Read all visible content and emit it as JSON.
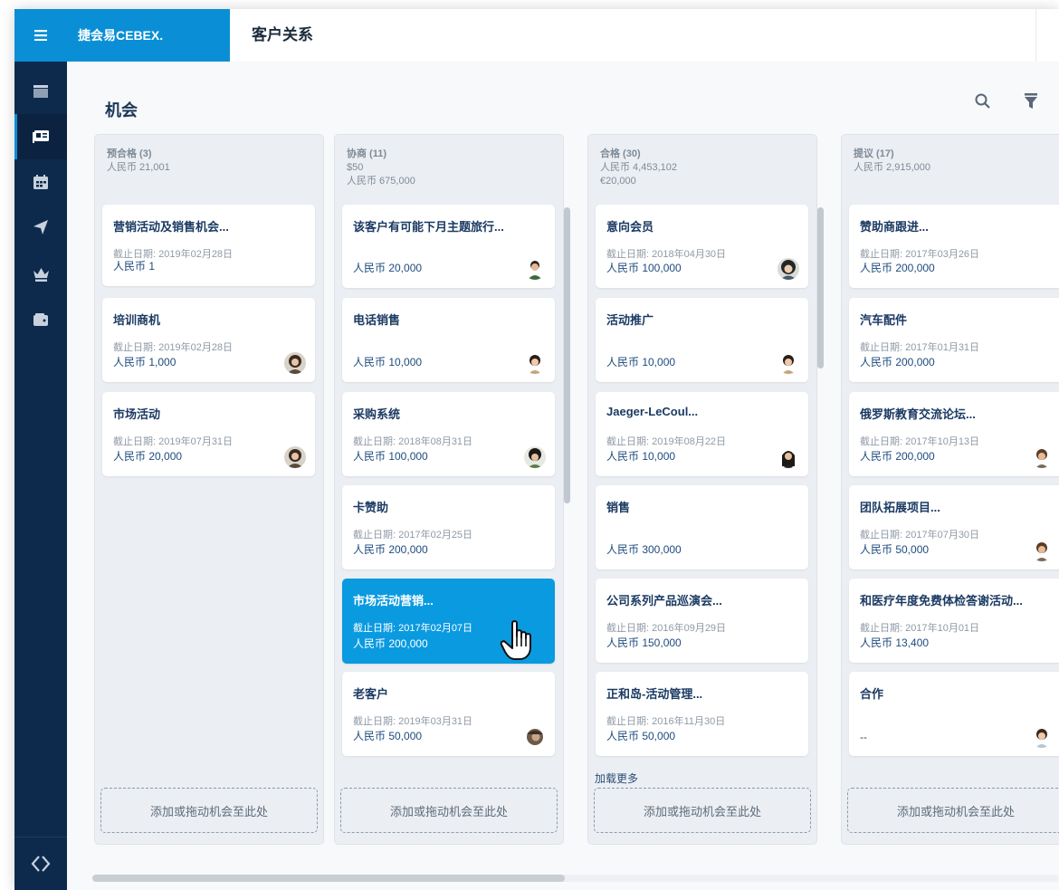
{
  "brand": "捷会易CEBEX.",
  "header_title": "客户关系",
  "page_title": "机会",
  "dropzone_label": "添加或拖动机会至此处",
  "load_more": "加载更多",
  "colors": {
    "accent": "#0a8fd6",
    "sidebar": "#0d2a4d",
    "selected_card": "#0a9ae0"
  },
  "sidebar_icons": [
    "menu-icon",
    "table-icon",
    "contact-card-icon",
    "calendar-icon",
    "paper-plane-icon",
    "crown-icon",
    "wallet-icon",
    "code-logo-icon"
  ],
  "columns": [
    {
      "name": "预合格 (3)",
      "totals": [
        "人民币 21,001"
      ],
      "cards": [
        {
          "title": "营销活动及销售机会...",
          "date": "截止日期: 2019年02月28日",
          "amount": "人民币 1",
          "avatar": false
        },
        {
          "title": "培训商机",
          "date": "截止日期: 2019年02月28日",
          "amount": "人民币 1,000",
          "avatar": true
        },
        {
          "title": "市场活动",
          "date": "截止日期: 2019年07月31日",
          "amount": "人民币 20,000",
          "avatar": true
        }
      ]
    },
    {
      "name": "协商 (11)",
      "totals": [
        "$50",
        "人民币 675,000"
      ],
      "cards": [
        {
          "title": "该客户有可能下月主题旅行...",
          "date": "",
          "amount": "人民币 20,000",
          "avatar": true
        },
        {
          "title": "电话销售",
          "date": "",
          "amount": "人民币 10,000",
          "avatar": true
        },
        {
          "title": "采购系统",
          "date": "截止日期: 2018年08月31日",
          "amount": "人民币 100,000",
          "avatar": true
        },
        {
          "title": "卡赞助",
          "date": "截止日期: 2017年02月25日",
          "amount": "人民币 200,000",
          "avatar": false
        },
        {
          "title": "市场活动营销...",
          "date": "截止日期: 2017年02月07日",
          "amount": "人民币 200,000",
          "avatar": false,
          "selected": true
        },
        {
          "title": "老客户",
          "date": "截止日期: 2019年03月31日",
          "amount": "人民币 50,000",
          "avatar": true
        }
      ]
    },
    {
      "name": "合格 (30)",
      "totals": [
        "人民币 4,453,102",
        "€20,000"
      ],
      "cards": [
        {
          "title": "意向会员",
          "date": "截止日期: 2018年04月30日",
          "amount": "人民币 100,000",
          "avatar": true
        },
        {
          "title": "活动推广",
          "date": "",
          "amount": "人民币 10,000",
          "avatar": true
        },
        {
          "title": "Jaeger-LeCoul...",
          "date": "截止日期: 2019年08月22日",
          "amount": "人民币 10,000",
          "avatar": true
        },
        {
          "title": "销售",
          "date": "",
          "amount": "人民币 300,000",
          "avatar": false
        },
        {
          "title": "公司系列产品巡演会...",
          "date": "截止日期: 2016年09月29日",
          "amount": "人民币 150,000",
          "avatar": false
        },
        {
          "title": "正和岛-活动管理...",
          "date": "截止日期: 2016年11月30日",
          "amount": "人民币 50,000",
          "avatar": false
        }
      ]
    },
    {
      "name": "提议 (17)",
      "totals": [
        "人民币 2,915,000"
      ],
      "cards": [
        {
          "title": "赞助商跟进...",
          "date": "截止日期: 2017年03月26日",
          "amount": "人民币 200,000",
          "avatar": false
        },
        {
          "title": "汽车配件",
          "date": "截止日期: 2017年01月31日",
          "amount": "人民币 200,000",
          "avatar": false
        },
        {
          "title": "俄罗斯教育交流论坛...",
          "date": "截止日期: 2017年10月13日",
          "amount": "人民币 200,000",
          "avatar": true
        },
        {
          "title": "团队拓展项目...",
          "date": "截止日期: 2017年07月30日",
          "amount": "人民币 50,000",
          "avatar": true
        },
        {
          "title": "和医疗年度免费体检答谢活动...",
          "date": "截止日期: 2017年10月01日",
          "amount": "人民币 13,400",
          "avatar": false
        },
        {
          "title": "合作",
          "date": "",
          "amount": "--",
          "avatar": true
        }
      ]
    }
  ]
}
